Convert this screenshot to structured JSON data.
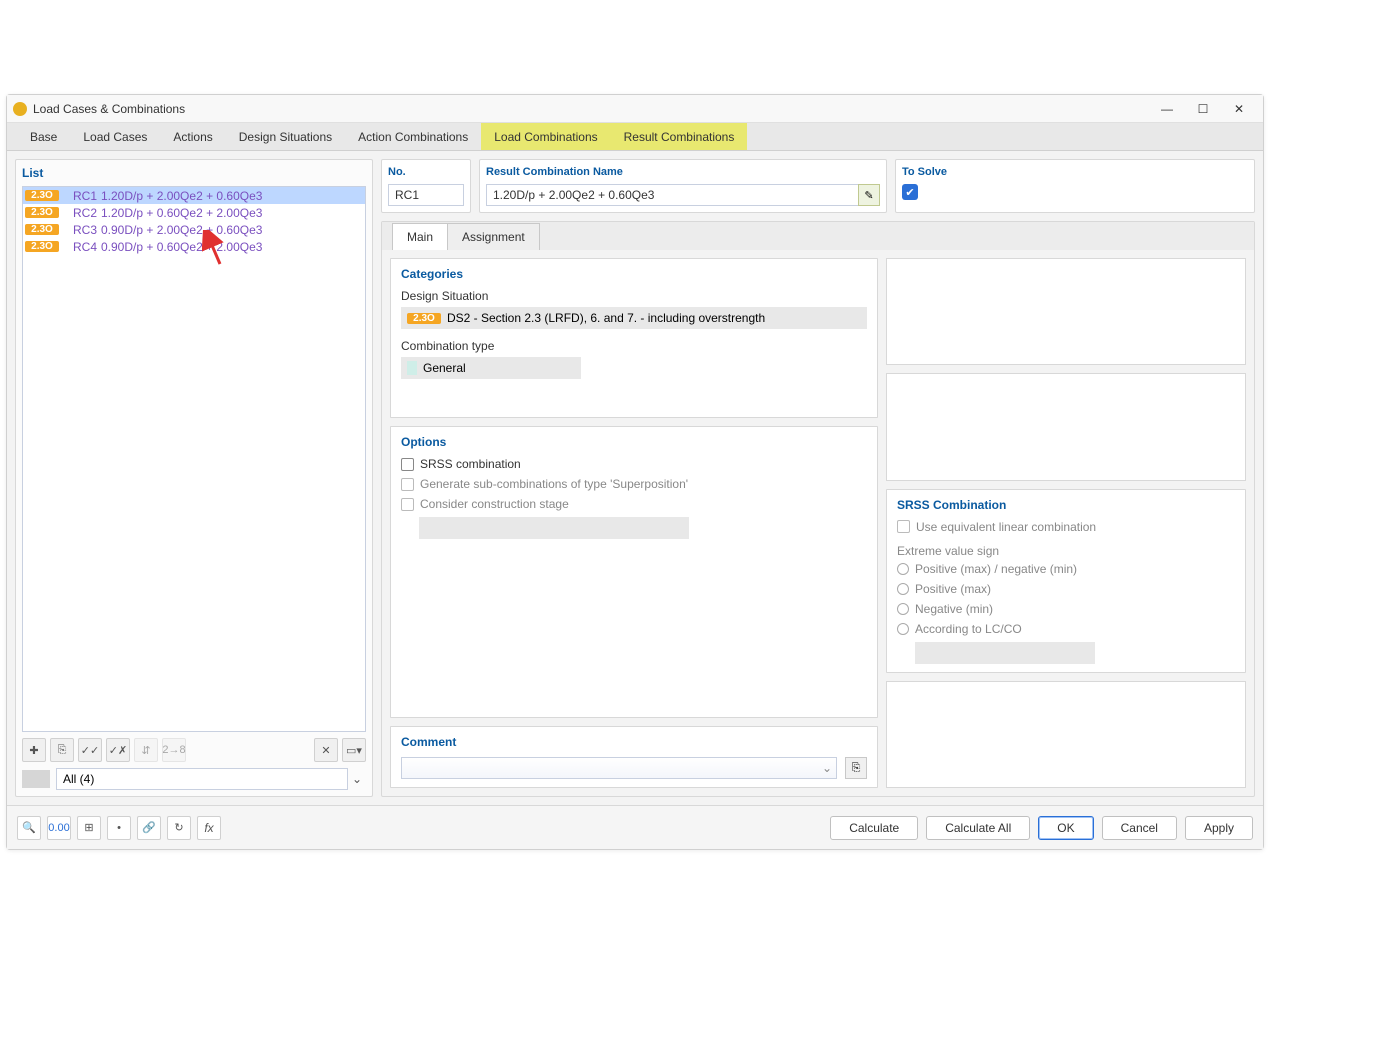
{
  "title": "Load Cases & Combinations",
  "tabs": [
    "Base",
    "Load Cases",
    "Actions",
    "Design Situations",
    "Action Combinations",
    "Load Combinations",
    "Result Combinations"
  ],
  "list": {
    "label": "List",
    "items": [
      {
        "badge": "2.3O",
        "id": "RC1",
        "desc": "1.20D/p + 2.00Qe2 + 0.60Qe3"
      },
      {
        "badge": "2.3O",
        "id": "RC2",
        "desc": "1.20D/p + 0.60Qe2 + 2.00Qe3"
      },
      {
        "badge": "2.3O",
        "id": "RC3",
        "desc": "0.90D/p + 2.00Qe2 + 0.60Qe3"
      },
      {
        "badge": "2.3O",
        "id": "RC4",
        "desc": "0.90D/p + 0.60Qe2 + 2.00Qe3"
      }
    ],
    "filter": "All (4)"
  },
  "header": {
    "no_label": "No.",
    "no_value": "RC1",
    "name_label": "Result Combination Name",
    "name_value": "1.20D/p + 2.00Qe2 + 0.60Qe3",
    "solve_label": "To Solve"
  },
  "inner_tabs": [
    "Main",
    "Assignment"
  ],
  "categories": {
    "heading": "Categories",
    "ds_label": "Design Situation",
    "ds_badge": "2.3O",
    "ds_value": "DS2 - Section 2.3 (LRFD), 6. and 7. - including overstrength",
    "ct_label": "Combination type",
    "ct_value": "General"
  },
  "options": {
    "heading": "Options",
    "srss": "SRSS combination",
    "gen": "Generate sub-combinations of type 'Superposition'",
    "cons": "Consider construction stage"
  },
  "srss_panel": {
    "heading": "SRSS Combination",
    "lin": "Use equivalent linear combination",
    "sign_label": "Extreme value sign",
    "r1": "Positive (max) / negative (min)",
    "r2": "Positive (max)",
    "r3": "Negative (min)",
    "r4": "According to LC/CO"
  },
  "comment": {
    "heading": "Comment"
  },
  "footer": {
    "calculate": "Calculate",
    "calculate_all": "Calculate All",
    "ok": "OK",
    "cancel": "Cancel",
    "apply": "Apply"
  }
}
